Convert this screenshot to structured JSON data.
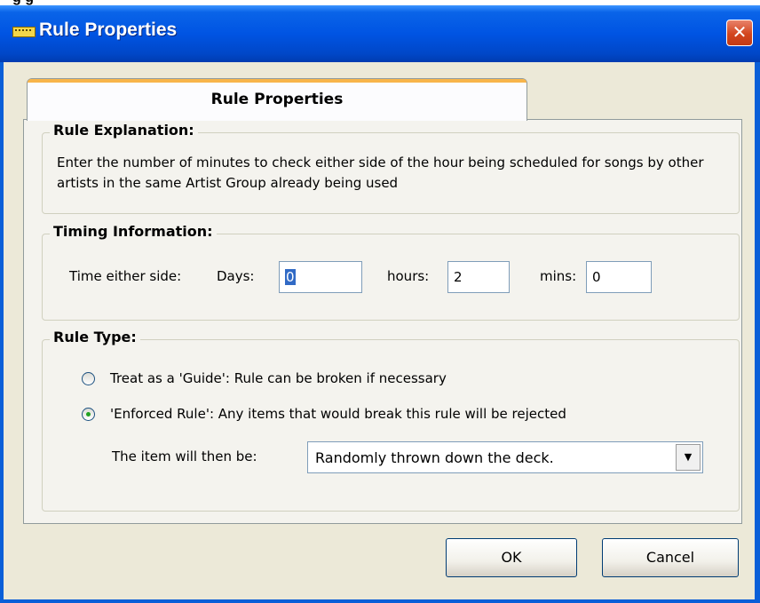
{
  "top_strip": {
    "text": "g g"
  },
  "window": {
    "title": "Rule Properties",
    "close_glyph": "✕"
  },
  "tab": {
    "label": "Rule Properties"
  },
  "explanation": {
    "legend": "Rule Explanation:",
    "text": "Enter the number of minutes to check either side of the hour being scheduled for songs by other artists in the same Artist Group already being used"
  },
  "timing": {
    "legend": "Timing Information:",
    "time_label": "Time either side:",
    "days_label": "Days:",
    "days_value": "0",
    "hours_label": "hours:",
    "hours_value": "2",
    "mins_label": "mins:",
    "mins_value": "0"
  },
  "rule_type": {
    "legend": "Rule Type:",
    "guide_label": "Treat as a 'Guide': Rule can be broken if necessary",
    "guide_selected": false,
    "enforced_label": "'Enforced Rule': Any items that would break this rule will be rejected",
    "enforced_selected": true,
    "item_then_label": "The item will then be:",
    "item_then_value": "Randomly thrown down the deck."
  },
  "buttons": {
    "ok": "OK",
    "cancel": "Cancel"
  },
  "icons": {
    "app": "ruler-icon",
    "close": "close-icon",
    "dropdown": "chevron-down-icon"
  }
}
